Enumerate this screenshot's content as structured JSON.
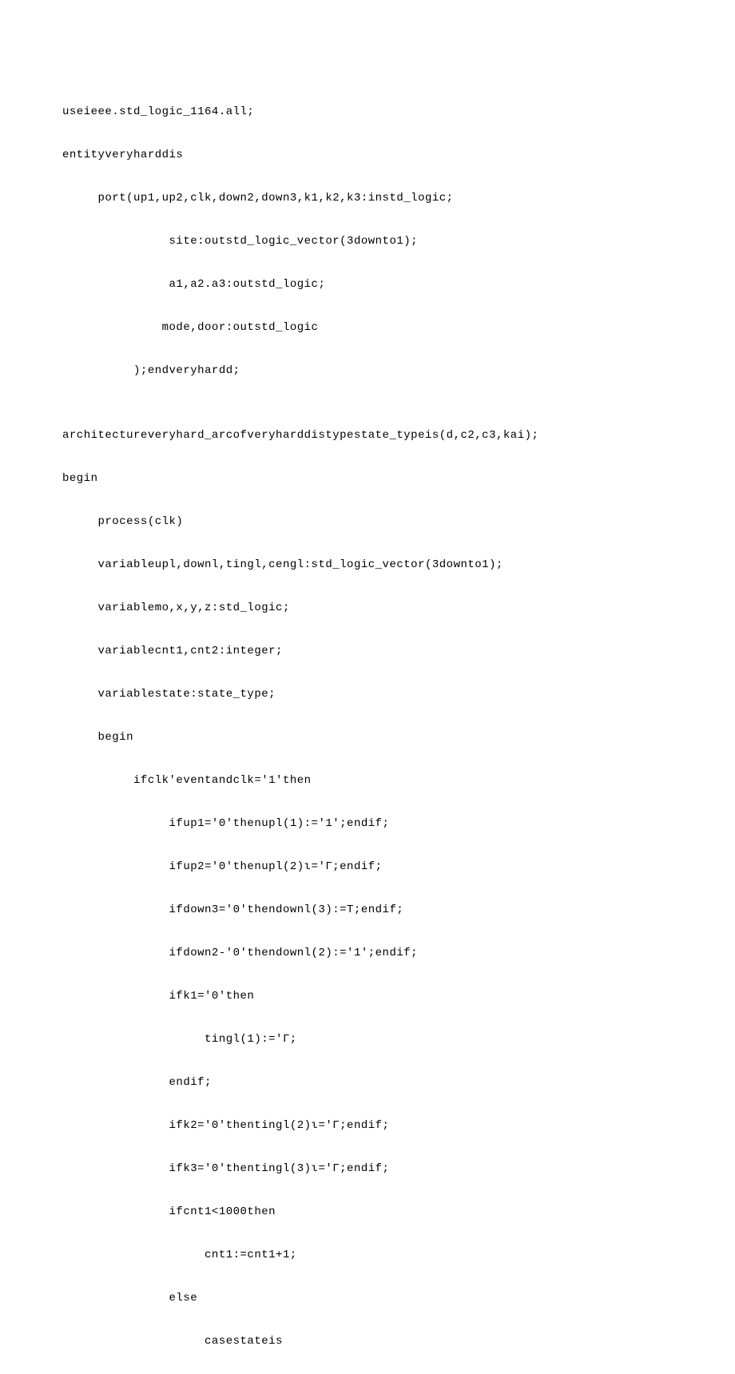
{
  "code": {
    "lines": [
      "useieee.std_logic_1164.all;",
      "entityveryharddis",
      "     port(up1,up2,clk,down2,down3,k1,k2,k3:instd_logic;",
      "               site:outstd_logic_vector(3downto1);",
      "               a1,a2.a3:outstd_logic;",
      "              mode,door:outstd_logic",
      "          );endveryhardd;",
      "",
      "architectureveryhard_arcofveryharddistypestate_typeis(d,c2,c3,kai);",
      "begin",
      "     process(clk)",
      "     variableupl,downl,tingl,cengl:std_logic_vector(3downto1);",
      "     variablemo,x,y,z:std_logic;",
      "     variablecnt1,cnt2:integer;",
      "     variablestate:state_type;",
      "     begin",
      "          ifclk'eventandclk='1'then",
      "               ifup1='0'thenupl(1):='1';endif;",
      "               ifup2='0'thenupl(2)ι='Γ;endif;",
      "               ifdown3='0'thendownl(3):=T;endif;",
      "               ifdown2-'0'thendownl(2):='1';endif;",
      "               ifk1='0'then",
      "                    tingl(1):='Γ;",
      "               endif;",
      "               ifk2='0'thentingl(2)ι='Γ;endif;",
      "               ifk3='0'thentingl(3)ι='Γ;endif;",
      "               ifcnt1<1000then",
      "                    cnt1:=cnt1+1;",
      "               else",
      "                    casestateis"
    ]
  }
}
